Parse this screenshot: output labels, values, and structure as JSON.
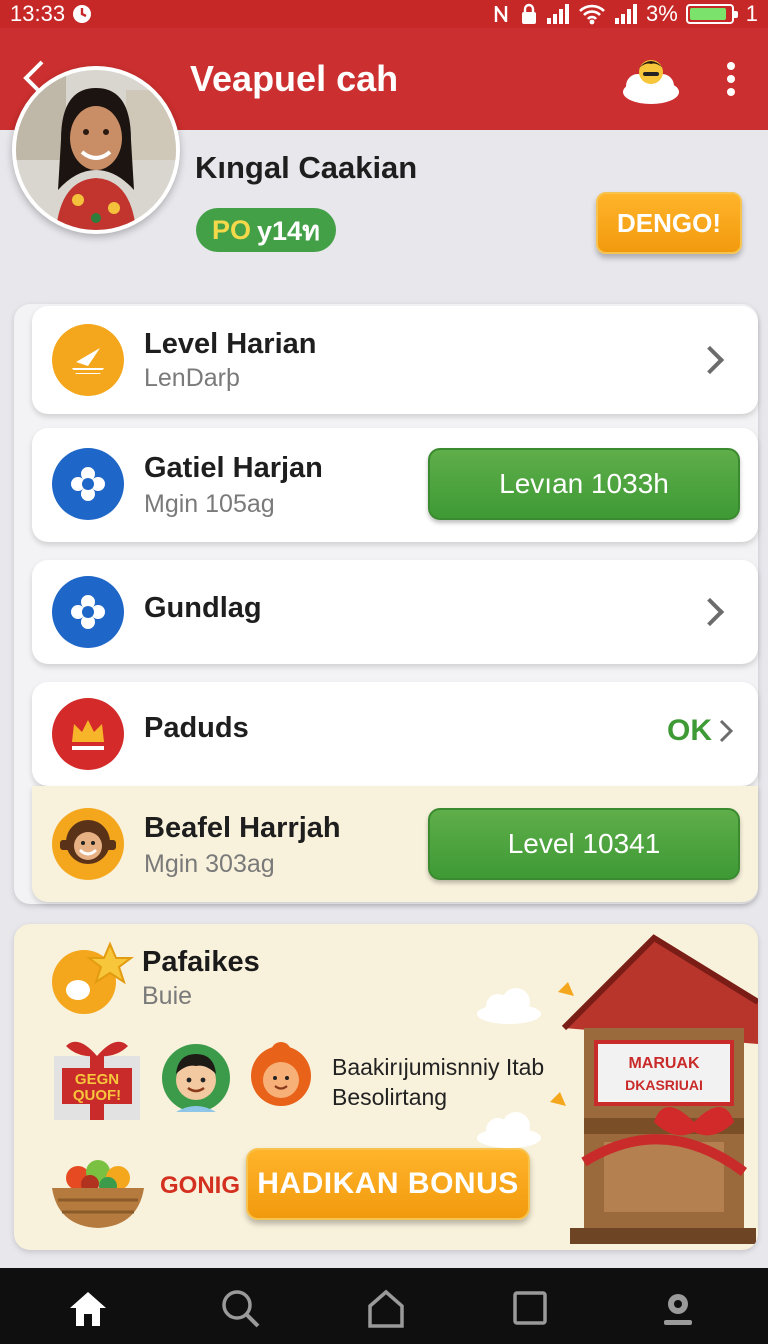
{
  "status_bar": {
    "time": "13:33",
    "battery_text": "3%",
    "sim_text": "1",
    "battery_level": 0.9
  },
  "app_bar": {
    "title": "Veapuel cah",
    "back_icon": "chevron-left-icon",
    "right_icon": "cloud-character-icon",
    "menu_icon": "more-vertical-icon"
  },
  "profile": {
    "name": "Kıngal Caakian",
    "badge_prefix": "PO",
    "badge_value": "y14ท",
    "action_button": "DENGO!"
  },
  "list": {
    "items": [
      {
        "title": "Level Harian",
        "subtitle": "LenDarþ",
        "icon": "paper-plane-icon",
        "icon_color": "#f4a71d",
        "action": "chevron"
      },
      {
        "title": "Gatiel Harjan",
        "subtitle": "Mgin 105ag",
        "icon": "gear-icon",
        "icon_color": "#1e66c8",
        "action_label": "Levıan 1033h"
      },
      {
        "title": "Gundlag",
        "subtitle": "",
        "icon": "gear-icon",
        "icon_color": "#1e66c8",
        "action": "chevron"
      },
      {
        "title": "Paduds",
        "subtitle": "",
        "icon": "crown-icon",
        "icon_color": "#d42a2a",
        "action_label": "OK"
      },
      {
        "title": "Beafel Harrjah",
        "subtitle": "Mgin 303ag",
        "icon": "character-avatar-icon",
        "icon_color": "#f4a71d",
        "action_label": "Level 10341"
      }
    ]
  },
  "promo": {
    "title": "Pafaikes",
    "subtitle": "Buie",
    "description_line1": "Baakirıjumisnniy Itab",
    "description_line2": "Besolirtang",
    "gift_text_line1": "GEGN",
    "gift_text_line2": "QUOF!",
    "side_label": "GONIG",
    "button_label": "HADIKAN BONUS",
    "sign_line1": "MARUAK",
    "sign_line2": "DKASRIUAI"
  },
  "nav": {
    "items": [
      {
        "icon": "home-icon",
        "active": true
      },
      {
        "icon": "search-icon",
        "active": false
      },
      {
        "icon": "house-outline-icon",
        "active": false
      },
      {
        "icon": "square-icon",
        "active": false
      },
      {
        "icon": "profile-icon",
        "active": false
      }
    ]
  },
  "colors": {
    "primary_red": "#cc2f2f",
    "accent_orange": "#f29a0e",
    "accent_green": "#43a047",
    "background": "#e7e7ec"
  }
}
